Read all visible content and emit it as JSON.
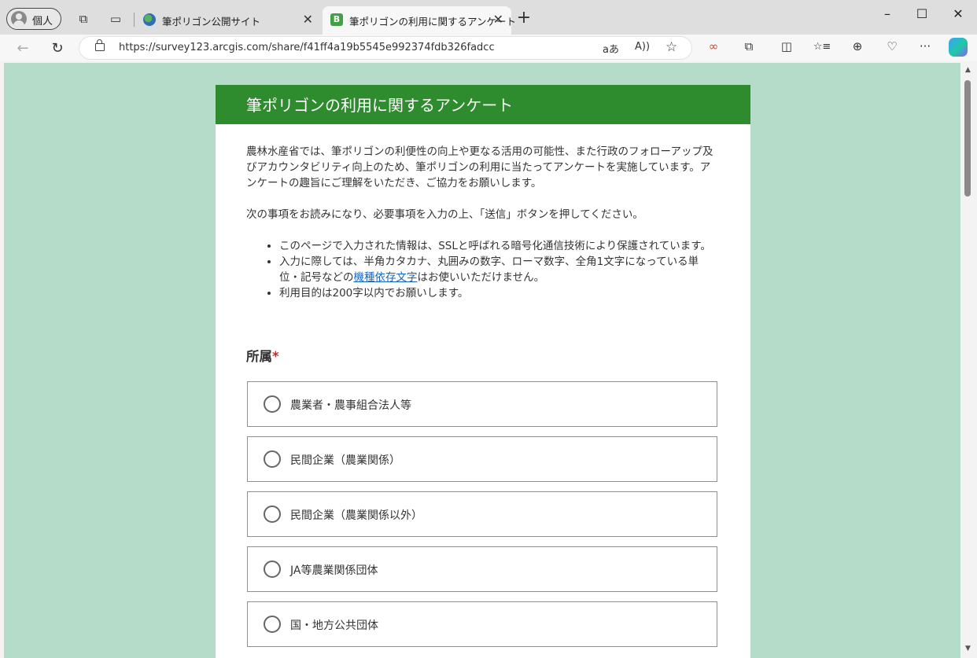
{
  "browser": {
    "profile_label": "個人",
    "tabs": [
      {
        "title": "筆ポリゴン公開サイト",
        "active": false
      },
      {
        "title": "筆ポリゴンの利用に関するアンケート",
        "active": true
      }
    ],
    "new_tab": "+",
    "window": {
      "minimize": "–",
      "maximize": "☐",
      "close": "✕"
    },
    "address_bar": {
      "url": "https://survey123.arcgis.com/share/f41ff4a19b5545e992374fdb326fadcc"
    },
    "icons": {
      "back": "←",
      "refresh": "↻",
      "translate": "aあ",
      "read_aloud": "A))",
      "favorite": "☆",
      "link": "∞",
      "extensions": "⧉",
      "split": "◫",
      "favorites": "☆≡",
      "collections": "⊕",
      "health": "♡",
      "more": "···"
    }
  },
  "survey": {
    "title": "筆ポリゴンの利用に関するアンケート",
    "intro": "農林水産省では、筆ポリゴンの利便性の向上や更なる活用の可能性、また行政のフォローアップ及びアカウンタビリティ向上のため、筆ポリゴンの利用に当たってアンケートを実施しています。アンケートの趣旨にご理解をいただき、ご協力をお願いします。",
    "instruction": "次の事項をお読みになり、必要事項を入力の上、「送信」ボタンを押してください。",
    "bullets": {
      "b1": "このページで入力された情報は、SSLと呼ばれる暗号化通信技術により保護されています。",
      "b2_pre": "入力に際しては、半角カタカナ、丸囲みの数字、ローマ数字、全角1文字になっている単位・記号などの",
      "b2_link": "機種依存文字",
      "b2_post": "はお使いいただけません。",
      "b3": "利用目的は200字以内でお願いします。"
    },
    "question": {
      "label": "所属",
      "required_mark": "*"
    },
    "options": [
      "農業者・農事組合法人等",
      "民間企業（農業関係）",
      "民間企業（農業関係以外）",
      "JA等農業関係団体",
      "国・地方公共団体"
    ],
    "colors": {
      "header": "#2e8b2e",
      "background": "#b5dcc8",
      "required": "#c62828"
    }
  }
}
